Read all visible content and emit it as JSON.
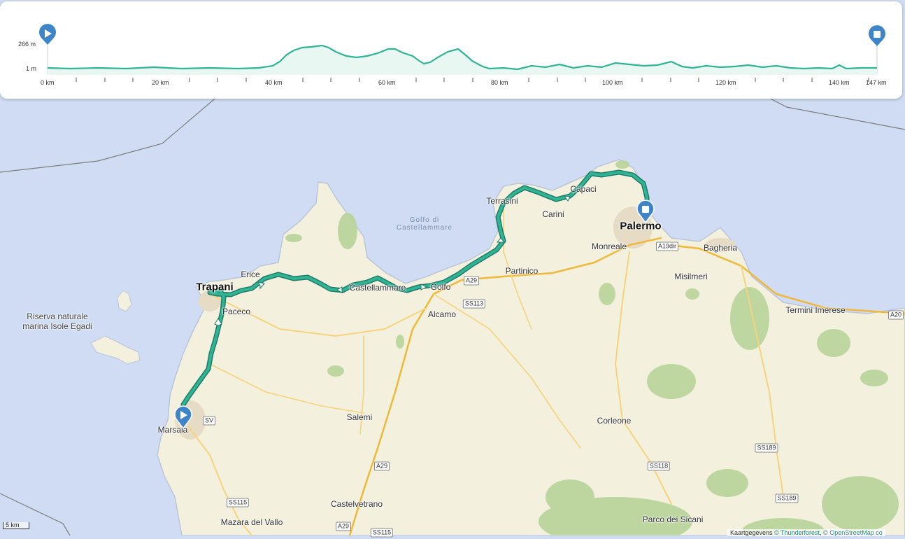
{
  "profile": {
    "elevation_max_label": "266 m",
    "elevation_min_label": "1 m",
    "distance_labels": [
      "0 km",
      "20 km",
      "40 km",
      "60 km",
      "80 km",
      "100 km",
      "120 km",
      "140 km",
      "147 km"
    ]
  },
  "map": {
    "places": [
      "Trapani",
      "Palermo",
      "Erice",
      "Paceco",
      "Marsala",
      "Salemi",
      "Castellammare",
      "Golfo",
      "Alcamo",
      "Partinico",
      "Terrasini",
      "Carini",
      "Capaci",
      "Monreale",
      "Bagheria",
      "Misilmeri",
      "Termini Imerese",
      "Corleone",
      "Castelvetrano",
      "Mazara del Vallo",
      "Parco dei Sicani"
    ],
    "sea_label": "Golfo di\nCastellammare",
    "reserve_label": "Riserva naturale\nmarina Isole Egadi",
    "road_shields": [
      "A29",
      "SS113",
      "A19dir",
      "A20",
      "SV",
      "A29",
      "SS115",
      "SS118",
      "SS189",
      "SS189",
      "A29",
      "SS115"
    ],
    "scale_label": "5 km",
    "attribution_prefix": "Kaartgegevens",
    "attribution_links": [
      "© Thunderforest",
      "© OpenStreetMap co"
    ]
  },
  "colors": {
    "route": "#2fb596",
    "marker": "#3d84c8",
    "sea": "#cfdcf3",
    "land": "#f2efdc"
  }
}
